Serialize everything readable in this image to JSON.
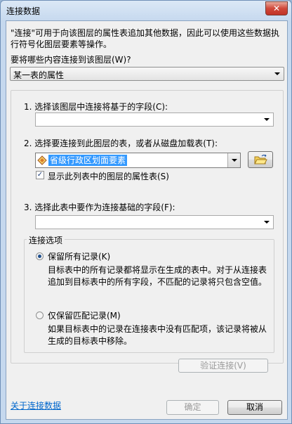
{
  "window": {
    "title": "连接数据",
    "close_label": "✕"
  },
  "intro_text": "\"连接\"可用于向该图层的属性表追加其他数据，因此可以使用这些数据执行符号化图层要素等操作。",
  "join_what_label": "要将哪些内容连接到该图层(W)?",
  "join_what_value": "某一表的属性",
  "step1_label": "1. 选择该图层中连接将基于的字段(C):",
  "step1_value": "",
  "step2_label": "2. 选择要连接到此图层的表，或者从磁盘加载表(T):",
  "step2_value": "省级行政区划面要素",
  "show_layers_label": "显示此列表中的图层的属性表(S)",
  "show_layers_checked": true,
  "step3_label": "3. 选择此表中要作为连接基础的字段(F):",
  "step3_value": "",
  "join_options": {
    "title": "连接选项",
    "keep_all_label": "保留所有记录(K)",
    "keep_all_desc": "目标表中的所有记录都将显示在生成的表中。对于从连接表追加到目标表中的所有字段，不匹配的记录将只包含空值。",
    "keep_matching_label": "仅保留匹配记录(M)",
    "keep_matching_desc": "如果目标表中的记录在连接表中没有匹配项，该记录将被从生成的目标表中移除。"
  },
  "validate_label": "验证连接(V)",
  "about_link": "关于连接数据",
  "ok_label": "确定",
  "cancel_label": "取消",
  "colors": {
    "selection": "#3399ff",
    "link": "#0066cc"
  }
}
